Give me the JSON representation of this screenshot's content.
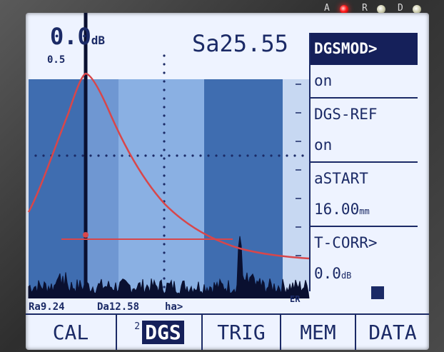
{
  "device": {
    "leds": [
      {
        "label": "A",
        "state": "on",
        "color": "#ff1a1a"
      },
      {
        "label": "R",
        "state": "off",
        "color": "#e0e0c0"
      },
      {
        "label": "D",
        "state": "off",
        "color": "#e0e0c0"
      }
    ]
  },
  "header": {
    "gain_value": "0.0",
    "gain_unit": "dB",
    "range_value": "0.5",
    "sa_readout": "Sa25.55"
  },
  "menu": {
    "items": [
      {
        "label": "DGSMOD>",
        "selected": true
      },
      {
        "label": "on"
      },
      {
        "label": "DGS-REF"
      },
      {
        "label": "on"
      },
      {
        "label": "aSTART"
      },
      {
        "label": "16.00",
        "unit": "mm"
      },
      {
        "label": "T-CORR>"
      },
      {
        "label": "0.0",
        "unit": "dB"
      }
    ]
  },
  "status": {
    "ra": "Ra9.24",
    "da": "Da12.58",
    "ha": "ha>",
    "er": "ER",
    "lock_icon": "lock-icon"
  },
  "softkeys": [
    {
      "label": "CAL",
      "number": ""
    },
    {
      "label": "DGS",
      "number": "2",
      "selected": true
    },
    {
      "label": "TRIG",
      "number": ""
    },
    {
      "label": "MEM",
      "number": ""
    },
    {
      "label": "DATA",
      "number": ""
    }
  ],
  "colors": {
    "screen_bg": "#eef3ff",
    "gate_band_dark": "#3f6db0",
    "gate_band_light": "#8ab0e3",
    "ink": "#1b2a66",
    "dgs_curve": "#d8464a",
    "echo_fill": "#0a1030"
  }
}
